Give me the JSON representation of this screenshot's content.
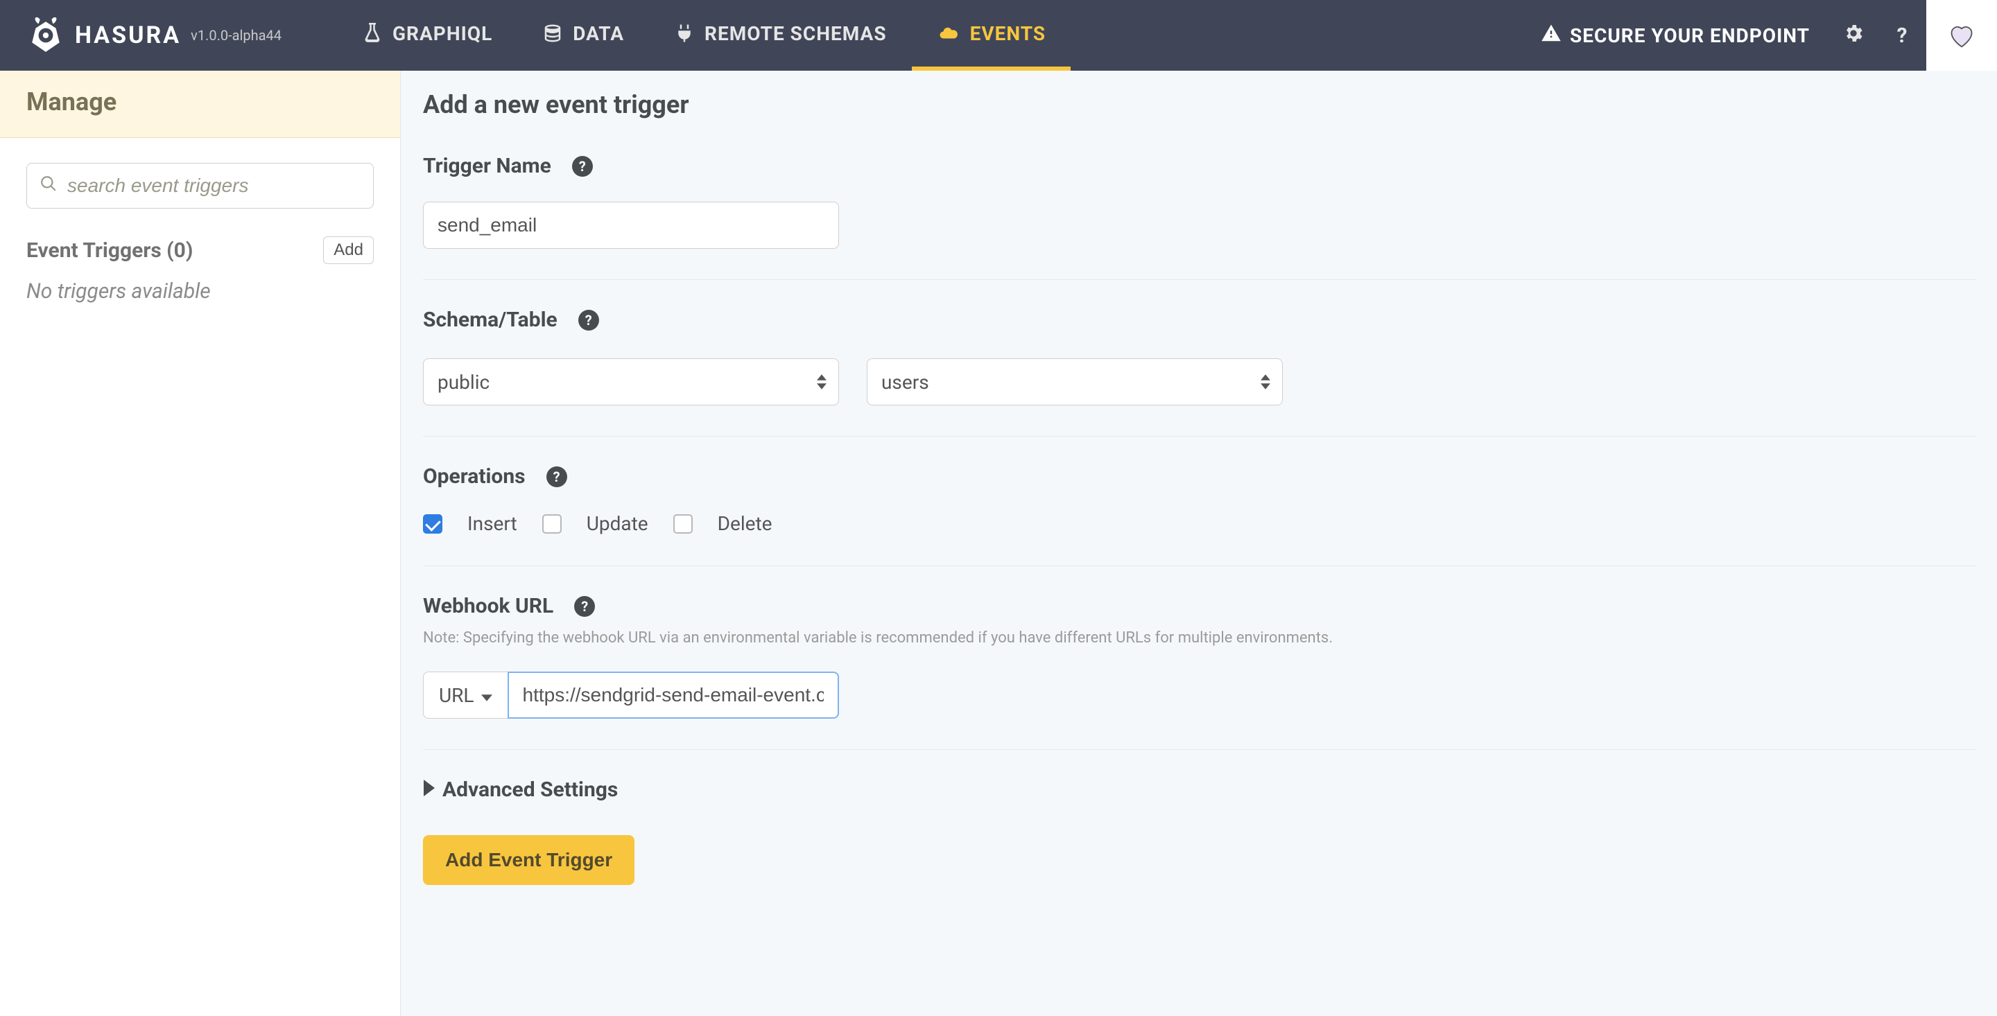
{
  "brand": {
    "name": "HASURA",
    "version": "v1.0.0-alpha44"
  },
  "nav": {
    "tabs": [
      {
        "label": "GRAPHIQL"
      },
      {
        "label": "DATA"
      },
      {
        "label": "REMOTE SCHEMAS"
      },
      {
        "label": "EVENTS"
      }
    ],
    "secure": "SECURE YOUR ENDPOINT"
  },
  "sidebar": {
    "manage": "Manage",
    "search_placeholder": "search event triggers",
    "triggers_label": "Event Triggers (0)",
    "triggers_count": 0,
    "add_label": "Add",
    "empty": "No triggers available"
  },
  "form": {
    "title": "Add a new event trigger",
    "trigger_name_label": "Trigger Name",
    "trigger_name_value": "send_email",
    "schema_label": "Schema/Table",
    "schema_value": "public",
    "table_value": "users",
    "ops_label": "Operations",
    "ops": {
      "insert": "Insert",
      "update": "Update",
      "delete": "Delete"
    },
    "ops_checked": {
      "insert": true,
      "update": false,
      "delete": false
    },
    "webhook_label": "Webhook URL",
    "webhook_note": "Note: Specifying the webhook URL via an environmental variable is recommended if you have different URLs for multiple environments.",
    "url_btn": "URL",
    "url_value": "https://sendgrid-send-email-event.c",
    "advanced_label": "Advanced Settings",
    "submit": "Add Event Trigger"
  }
}
